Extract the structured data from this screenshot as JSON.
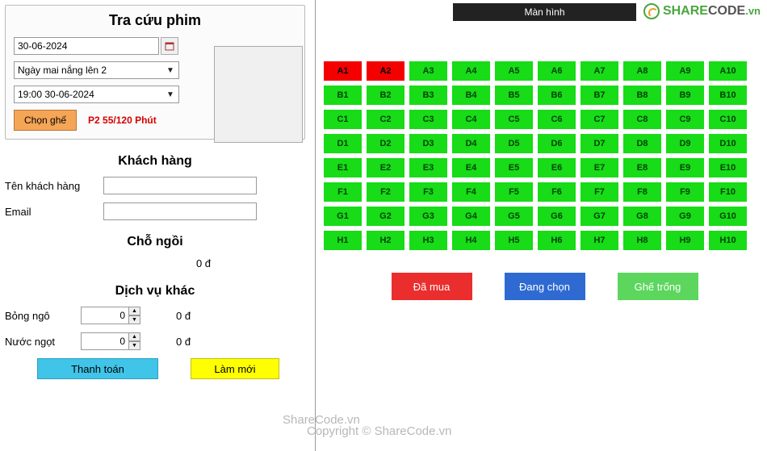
{
  "lookup": {
    "title": "Tra cứu phim",
    "date": "30-06-2024",
    "movie": "Ngày mai nắng lên 2",
    "showtime": "19:00 30-06-2024",
    "choose_seat_btn": "Chọn ghế",
    "status": "P2 55/120 Phút"
  },
  "customer": {
    "title": "Khách hàng",
    "name_label": "Tên khách hàng",
    "name_value": "",
    "email_label": "Email",
    "email_value": ""
  },
  "seating_section": {
    "title": "Chỗ ngồi",
    "total": "0 đ"
  },
  "services": {
    "title": "Dịch vụ khác",
    "popcorn_label": "Bỏng ngô",
    "popcorn_qty": "0",
    "popcorn_price": "0 đ",
    "soda_label": "Nước ngọt",
    "soda_qty": "0",
    "soda_price": "0 đ"
  },
  "buttons": {
    "pay": "Thanh toán",
    "reset": "Làm mới"
  },
  "screen_label": "Màn hình",
  "seat_rows": [
    "A",
    "B",
    "C",
    "D",
    "E",
    "F",
    "G",
    "H"
  ],
  "seat_cols": [
    1,
    2,
    3,
    4,
    5,
    6,
    7,
    8,
    9,
    10
  ],
  "bought_seats": [
    "A1",
    "A2"
  ],
  "legend": {
    "bought": "Đã mua",
    "selecting": "Đang chọn",
    "free": "Ghế trống"
  },
  "watermark": {
    "brand_share": "SHARE",
    "brand_code": "CODE",
    "brand_vn": ".vn",
    "line1": "ShareCode.vn",
    "line2": "Copyright © ShareCode.vn"
  }
}
